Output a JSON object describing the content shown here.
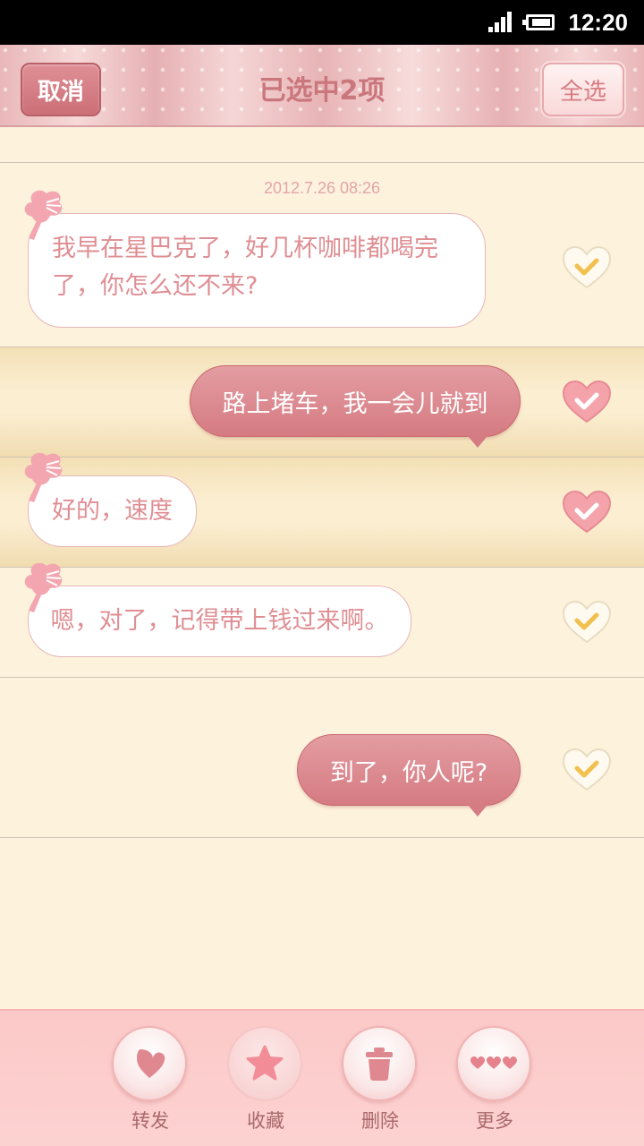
{
  "status_bar": {
    "time": "12:20",
    "signal_icon": "signal-icon",
    "battery_icon": "battery-icon"
  },
  "header": {
    "cancel_label": "取消",
    "title": "已选中2项",
    "select_all_label": "全选"
  },
  "messages": [
    {
      "timestamp": "2012.7.26   08:26",
      "direction": "incoming",
      "text_lines": [
        "我早在星巴克了，好几杯咖啡都喝完",
        "了，你怎么还不来?"
      ],
      "selected": false
    },
    {
      "direction": "outgoing",
      "text": "路上堵车，我一会儿就到",
      "selected": true
    },
    {
      "direction": "incoming",
      "text": "好的，速度",
      "selected": true
    },
    {
      "direction": "incoming",
      "text": "嗯，对了，记得带上钱过来啊。",
      "selected": false
    },
    {
      "direction": "outgoing",
      "text": "到了，你人呢?",
      "selected": false
    }
  ],
  "toolbar": {
    "items": [
      {
        "label": "转发",
        "icon": "heart-forward-icon"
      },
      {
        "label": "收藏",
        "icon": "star-icon"
      },
      {
        "label": "删除",
        "icon": "trash-icon"
      },
      {
        "label": "更多",
        "icon": "more-hearts-icon"
      }
    ]
  },
  "colors": {
    "accent": "#d57b82",
    "background": "#fdf2dc",
    "selected_row": "#fbeed1",
    "toolbar": "#fbc9c8"
  }
}
